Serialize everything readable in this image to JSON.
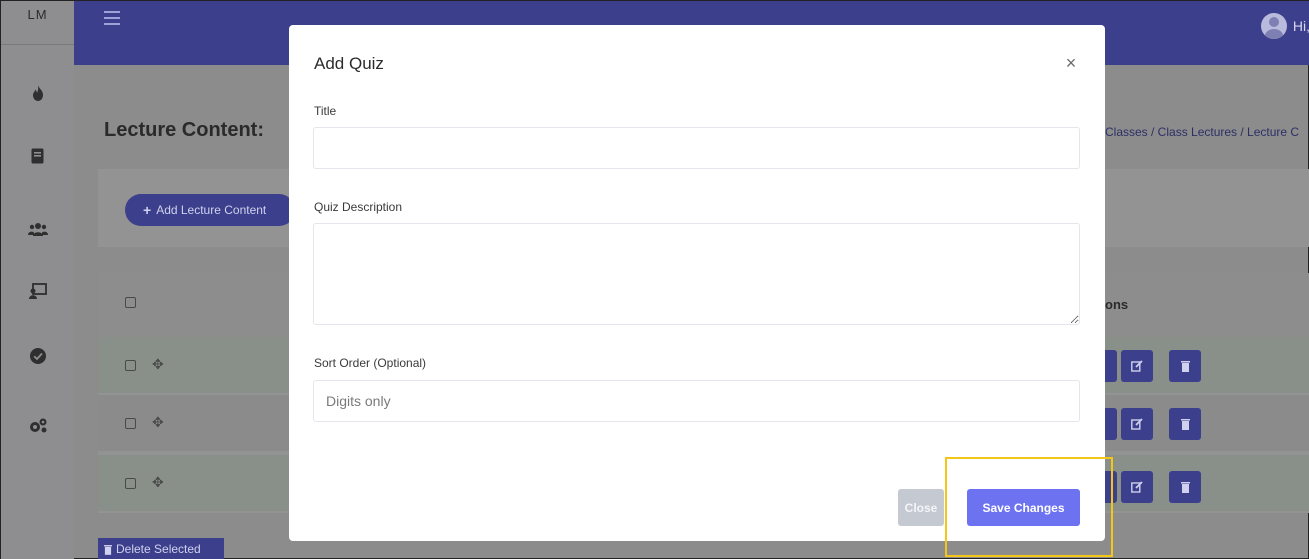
{
  "app": {
    "logo_text": "LM",
    "user_greeting": "Hi,"
  },
  "sidebar": {
    "items": [
      {
        "icon": "fire-icon"
      },
      {
        "icon": "book-icon"
      },
      {
        "icon": "users-icon"
      },
      {
        "icon": "presentation-icon"
      },
      {
        "icon": "check-circle-icon"
      },
      {
        "icon": "gears-icon"
      }
    ]
  },
  "page": {
    "title": "Lecture Content:",
    "breadcrumb": "Classes  /  Class Lectures  /  Lecture C",
    "add_button_label": "Add Lecture Content",
    "actions_header": "ons",
    "delete_selected_label": "Delete Selected"
  },
  "modal": {
    "title": "Add Quiz",
    "close_symbol": "×",
    "fields": {
      "title": {
        "label": "Title",
        "value": "",
        "placeholder": ""
      },
      "description": {
        "label": "Quiz Description",
        "value": "",
        "placeholder": ""
      },
      "sort_order": {
        "label": "Sort Order (Optional)",
        "value": "",
        "placeholder": "Digits only"
      }
    },
    "buttons": {
      "close": "Close",
      "save": "Save Changes"
    }
  },
  "colors": {
    "primary": "#3c3f8c",
    "save_button": "#6d72f0",
    "highlight": "#f5c518"
  }
}
